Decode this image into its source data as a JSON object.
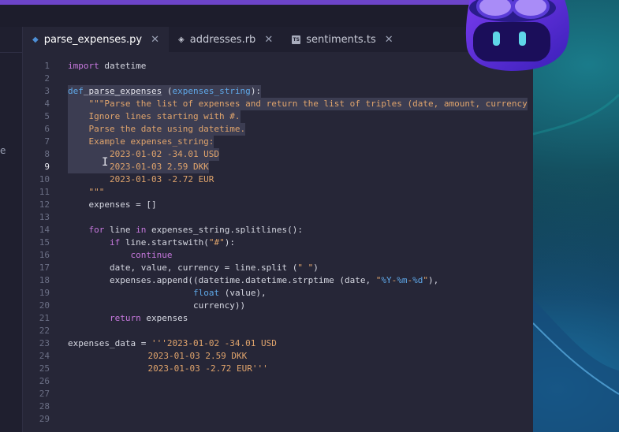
{
  "tabs": [
    {
      "icon": "python-icon",
      "label": "parse_expenses.py",
      "active": true
    },
    {
      "icon": "ruby-icon",
      "label": "addresses.rb",
      "active": false
    },
    {
      "icon": "typescript-icon",
      "label": "sentiments.ts",
      "active": false
    }
  ],
  "sidebar": {
    "partial_letter": "e"
  },
  "lines": [
    {
      "n": "1"
    },
    {
      "n": "2"
    },
    {
      "n": "3"
    },
    {
      "n": "4"
    },
    {
      "n": "5"
    },
    {
      "n": "6"
    },
    {
      "n": "7"
    },
    {
      "n": "8"
    },
    {
      "n": "9"
    },
    {
      "n": "10"
    },
    {
      "n": "11"
    },
    {
      "n": "12"
    },
    {
      "n": "13"
    },
    {
      "n": "14"
    },
    {
      "n": "15"
    },
    {
      "n": "16"
    },
    {
      "n": "17"
    },
    {
      "n": "18"
    },
    {
      "n": "19"
    },
    {
      "n": "20"
    },
    {
      "n": "21"
    },
    {
      "n": "22"
    },
    {
      "n": "23"
    },
    {
      "n": "24"
    },
    {
      "n": "25"
    },
    {
      "n": "26"
    },
    {
      "n": "27"
    },
    {
      "n": "28"
    },
    {
      "n": "29"
    }
  ],
  "code": {
    "l1_kw": "import",
    "l1_rest": " datetime",
    "l3_kw": "def",
    "l3_fn": " parse_expenses",
    "l3_open": " (",
    "l3_param": "expenses_string",
    "l3_close": "):",
    "l4": "    \"\"\"Parse the list of expenses and return the list of triples (date, amount, currency",
    "l5": "    Ignore lines starting with #.",
    "l6": "    Parse the date using datetime.",
    "l7": "    Example expenses_string:",
    "l8": "        2023-01-02 -34.01 USD",
    "l9": "        2023-01-03 2.59 DKK",
    "l10": "        2023-01-03 -2.72 EUR",
    "l11": "    \"\"\"",
    "l12": "    expenses = []",
    "l14_kw": "    for",
    "l14_a": " line ",
    "l14_in": "in",
    "l14_b": " expenses_string.splitlines():",
    "l15_kw": "        if",
    "l15_a": " line.startswith(",
    "l15_s": "\"#\"",
    "l15_b": "):",
    "l16": "            continue",
    "l17_a": "        date, value, currency = line.split (",
    "l17_s": "\" \"",
    "l17_b": ")",
    "l18_a": "        expenses.append((datetime.datetime.strptime (date, ",
    "l18_s1": "\"",
    "l18_f1": "%Y",
    "l18_s2": "-",
    "l18_f2": "%m",
    "l18_s3": "-",
    "l18_f3": "%d",
    "l18_s4": "\"",
    "l18_b": "),",
    "l19_pad": "                        ",
    "l19_fn": "float",
    "l19_b": " (value),",
    "l20": "                        currency))",
    "l21_kw": "        return",
    "l21_b": " expenses",
    "l23_a": "expenses_data = ",
    "l23_s": "'''2023-01-02 -34.01 USD",
    "l24": "            2023-01-03 2.59 DKK",
    "l25": "            2023-01-03 -2.72 EUR'''"
  },
  "cursor": {
    "icon": "text-cursor-icon",
    "glyph": "I"
  },
  "current_line": "9"
}
